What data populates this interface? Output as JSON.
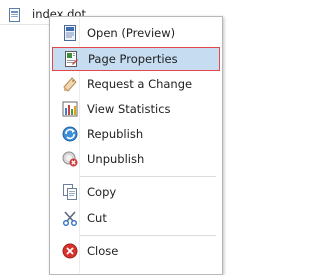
{
  "background_item": {
    "label": "index.dot",
    "icon": "page-icon"
  },
  "context_menu": {
    "items": [
      {
        "label": "Open (Preview)",
        "icon": "document-preview-icon",
        "active": false
      },
      {
        "label": "Page Properties",
        "icon": "page-properties-icon",
        "active": true
      },
      {
        "label": "Request a Change",
        "icon": "request-change-icon",
        "active": false
      },
      {
        "label": "View Statistics",
        "icon": "statistics-icon",
        "active": false
      },
      {
        "label": "Republish",
        "icon": "republish-icon",
        "active": false
      },
      {
        "label": "Unpublish",
        "icon": "unpublish-icon",
        "active": false
      },
      {
        "label": "Copy",
        "icon": "copy-icon",
        "active": false
      },
      {
        "label": "Cut",
        "icon": "cut-icon",
        "active": false
      },
      {
        "label": "Close",
        "icon": "close-icon",
        "active": false
      }
    ]
  },
  "colors": {
    "highlight_bg": "#c6dcf1",
    "highlight_border": "#e0484d"
  }
}
